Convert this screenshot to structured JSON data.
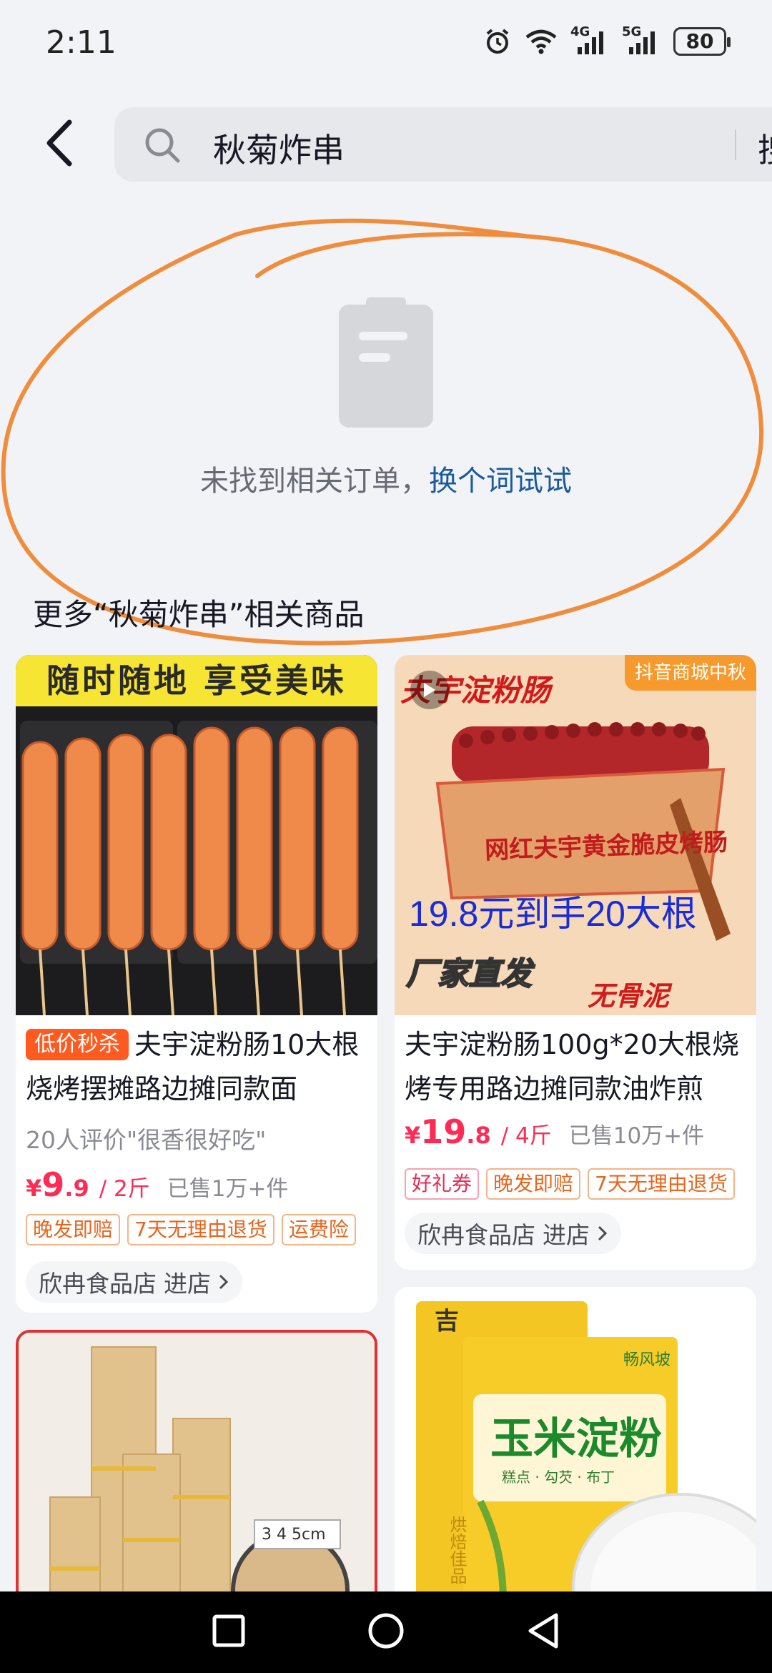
{
  "status_bar": {
    "time": "2:11",
    "battery": "80",
    "network_1": "4G",
    "network_2": "5G",
    "icons": [
      "alarm-icon",
      "wifi-icon",
      "signal-icon",
      "signal-icon",
      "battery-icon"
    ]
  },
  "header": {
    "search_query": "秋菊炸串",
    "search_button_label": "搜"
  },
  "empty_state": {
    "message": "未找到相关订单，",
    "retry_link": "换个词试试"
  },
  "section": {
    "title": "更多“秋菊炸串”相关商品"
  },
  "products": [
    {
      "banner_text": "随时随地 享受美味",
      "badge": "低价秒杀",
      "title": "夫宇淀粉肠10大根烧烤摆摊路边摊同款面",
      "review": "20人评价\"很香很好吃\"",
      "price_symbol": "¥",
      "price_int": "9",
      "price_dec": ".9",
      "unit": "/ 2斤",
      "sold": "已售1万+件",
      "tags": [
        "晚发即赔",
        "7天无理由退货",
        "运费险"
      ],
      "shop": "欣冉食品店",
      "shop_link": "进店"
    },
    {
      "brand_text": "夫宇淀粉肠",
      "corner_tag": "抖音商城中秋",
      "box_text": "网红夫宇黄金脆皮烤肠",
      "promo_text": "19.8元到手20大根",
      "factory_text": "厂家直发",
      "feature_text": "无骨泥",
      "title": "夫宇淀粉肠100g*20大根烧烤专用路边摊同款油炸煎",
      "price_symbol": "¥",
      "price_int": "19",
      "price_dec": ".8",
      "unit": "/ 4斤",
      "sold": "已售10万+件",
      "tags": [
        "好礼券",
        "晚发即赔",
        "7天无理由退货"
      ],
      "shop": "欣冉食品店",
      "shop_link": "进店"
    },
    {
      "ruler_text": "3 4 5cm"
    },
    {
      "brand_small": "吉",
      "brand_logo": "畅风坡",
      "product_name": "玉米淀粉",
      "sub_text": "糕点 · 勾芡 · 布丁",
      "side_text": "烘焙佳品"
    }
  ],
  "nav": {
    "icons": [
      "recent-apps-icon",
      "home-icon",
      "back-nav-icon"
    ]
  },
  "colors": {
    "accent_red": "#fe2c55",
    "link_blue": "#1a5a9e",
    "annotation_orange": "#ef8d3c",
    "background": "#f2f3f7"
  }
}
